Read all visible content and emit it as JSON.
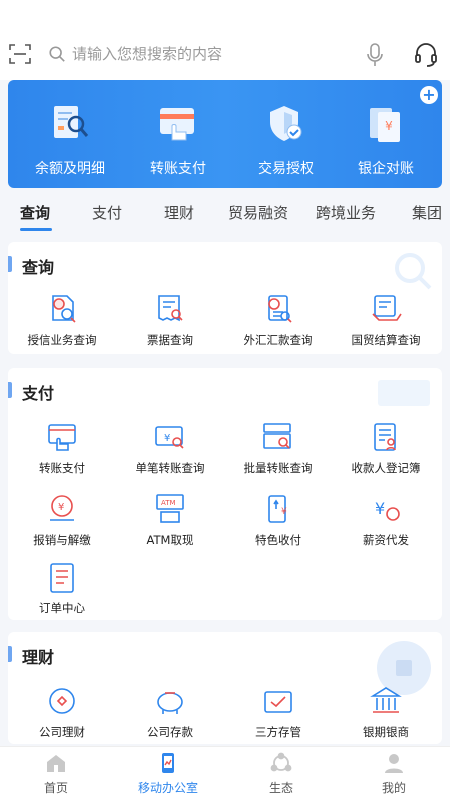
{
  "search": {
    "placeholder": "请输入您想搜索的内容"
  },
  "banner": {
    "items": [
      {
        "label": "余额及明细",
        "icon": "balance-detail-icon"
      },
      {
        "label": "转账支付",
        "icon": "transfer-pay-icon"
      },
      {
        "label": "交易授权",
        "icon": "transaction-auth-icon"
      },
      {
        "label": "银企对账",
        "icon": "bank-reconcile-icon"
      }
    ],
    "add_label": "+"
  },
  "tabs": [
    {
      "label": "查询",
      "active": true
    },
    {
      "label": "支付"
    },
    {
      "label": "理财"
    },
    {
      "label": "贸易融资"
    },
    {
      "label": "跨境业务"
    },
    {
      "label": "集团"
    }
  ],
  "sections": {
    "query": {
      "title": "查询",
      "items": [
        {
          "label": "授信业务查询",
          "icon": "credit-query-icon"
        },
        {
          "label": "票据查询",
          "icon": "bill-query-icon"
        },
        {
          "label": "外汇汇款查询",
          "icon": "fx-remit-query-icon"
        },
        {
          "label": "国贸结算查询",
          "icon": "trade-settle-query-icon"
        }
      ]
    },
    "payment": {
      "title": "支付",
      "items": [
        {
          "label": "转账支付",
          "icon": "transfer-icon"
        },
        {
          "label": "单笔转账查询",
          "icon": "single-transfer-query-icon"
        },
        {
          "label": "批量转账查询",
          "icon": "batch-transfer-query-icon"
        },
        {
          "label": "收款人登记簿",
          "icon": "payee-register-icon"
        },
        {
          "label": "报销与解缴",
          "icon": "reimburse-icon"
        },
        {
          "label": "ATM取现",
          "icon": "atm-icon"
        },
        {
          "label": "特色收付",
          "icon": "special-pay-icon"
        },
        {
          "label": "薪资代发",
          "icon": "payroll-icon"
        },
        {
          "label": "订单中心",
          "icon": "order-center-icon"
        }
      ]
    },
    "wealth": {
      "title": "理财",
      "items": [
        {
          "label": "公司理财",
          "icon": "corp-wealth-icon"
        },
        {
          "label": "公司存款",
          "icon": "corp-deposit-icon"
        },
        {
          "label": "三方存管",
          "icon": "third-party-custody-icon"
        },
        {
          "label": "银期银商",
          "icon": "bank-futures-icon"
        }
      ]
    }
  },
  "bottom_nav": [
    {
      "label": "首页",
      "icon": "home-icon"
    },
    {
      "label": "移动办公室",
      "icon": "mobile-office-icon",
      "active": true
    },
    {
      "label": "生态",
      "icon": "ecology-icon"
    },
    {
      "label": "我的",
      "icon": "profile-icon"
    }
  ],
  "colors": {
    "primary": "#2f86ec",
    "icon_red": "#e8504f",
    "text": "#222222"
  }
}
